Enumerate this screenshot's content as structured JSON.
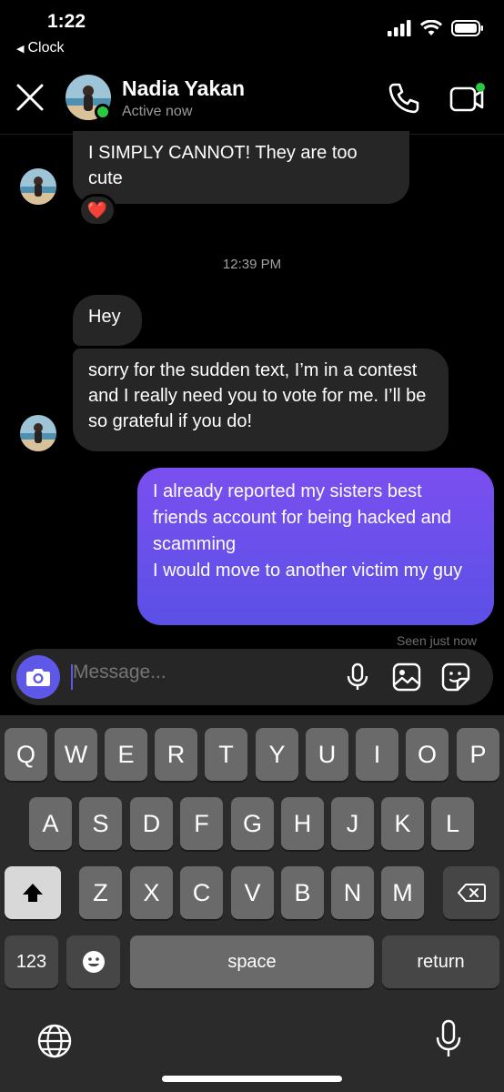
{
  "status_bar": {
    "time": "1:22",
    "back_label": "Clock"
  },
  "header": {
    "name": "Nadia Yakan",
    "status": "Active now"
  },
  "messages": [
    {
      "from": "them",
      "text": "I SIMPLY CANNOT! They are too cute",
      "reaction": "❤️"
    },
    {
      "from": "them",
      "text": "Hey"
    },
    {
      "from": "them",
      "text": "sorry for the sudden text, I’m in a contest and I really need you to vote for me. I’ll be so grateful if you do!"
    },
    {
      "from": "me",
      "line1": "I already reported my sisters best friends account for being hacked and scamming",
      "line2": "I would move to another victim my guy"
    }
  ],
  "timestamp": "12:39 PM",
  "seen": "Seen just now",
  "composer": {
    "placeholder": "Message..."
  },
  "keyboard": {
    "row1": [
      "Q",
      "W",
      "E",
      "R",
      "T",
      "Y",
      "U",
      "I",
      "O",
      "P"
    ],
    "row2": [
      "A",
      "S",
      "D",
      "F",
      "G",
      "H",
      "J",
      "K",
      "L"
    ],
    "row3": [
      "Z",
      "X",
      "C",
      "V",
      "B",
      "N",
      "M"
    ],
    "numbers": "123",
    "space": "space",
    "return": "return"
  },
  "colors": {
    "accent": "#5d58e8",
    "bubble_them": "#262626",
    "online": "#2ac940"
  }
}
